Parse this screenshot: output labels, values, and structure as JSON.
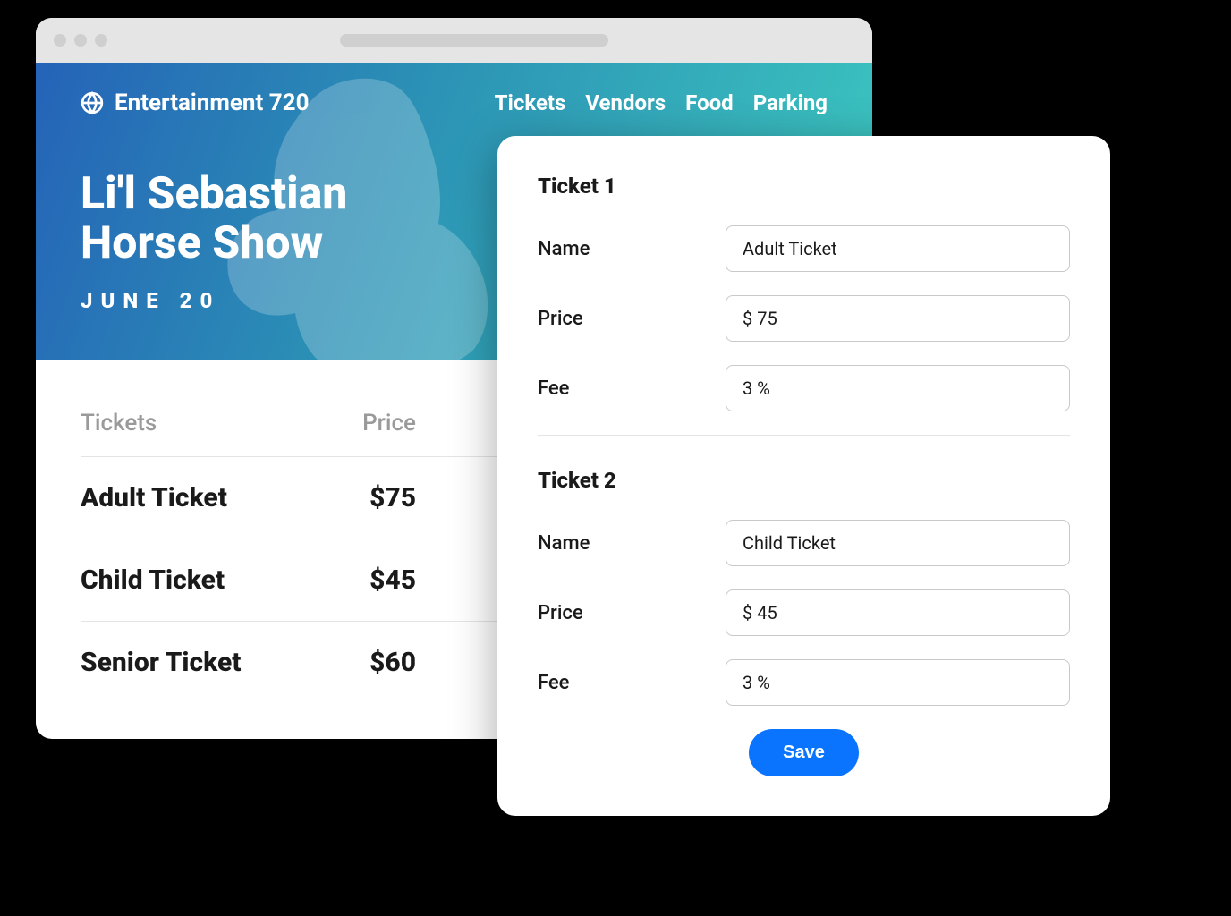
{
  "brand": "Entertainment 720",
  "nav": {
    "tickets": "Tickets",
    "vendors": "Vendors",
    "food": "Food",
    "parking": "Parking"
  },
  "event": {
    "title_line1": "Li'l Sebastian",
    "title_line2": "Horse Show",
    "date": "JUNE 20"
  },
  "ticket_list": {
    "header_tickets": "Tickets",
    "header_price": "Price",
    "rows": [
      {
        "name": "Adult Ticket",
        "price": "$75"
      },
      {
        "name": "Child Ticket",
        "price": "$45"
      },
      {
        "name": "Senior Ticket",
        "price": "$60"
      }
    ]
  },
  "edit_panel": {
    "sections": [
      {
        "title": "Ticket 1",
        "name_label": "Name",
        "name_value": "Adult Ticket",
        "price_label": "Price",
        "price_value": "$ 75",
        "fee_label": "Fee",
        "fee_value": "3 %"
      },
      {
        "title": "Ticket 2",
        "name_label": "Name",
        "name_value": "Child Ticket",
        "price_label": "Price",
        "price_value": "$ 45",
        "fee_label": "Fee",
        "fee_value": "3 %"
      }
    ],
    "save_label": "Save"
  }
}
